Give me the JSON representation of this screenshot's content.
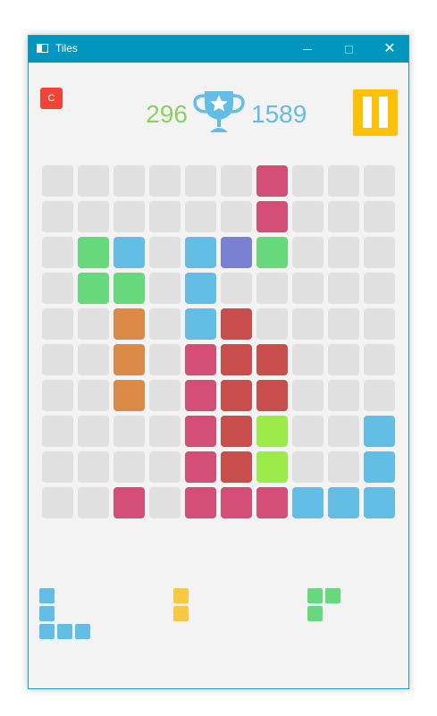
{
  "window": {
    "title": "Tiles",
    "controls": {
      "minimize": "minimize",
      "maximize": "maximize",
      "close": "✕"
    }
  },
  "hud": {
    "reset_label": "C",
    "score": "296",
    "best_score": "1589",
    "icons": {
      "trophy": "trophy-star-icon",
      "pause": "pause-icon"
    }
  },
  "colors": {
    "empty": "#e0e0e0",
    "P": "#d44f77",
    "B": "#64bde4",
    "G": "#67d87c",
    "O": "#dc8a48",
    "V": "#7c80d2",
    "R": "#c94f4f",
    "L": "#9deb4b",
    "Y": "#f7c843",
    "reset": "#f44336",
    "pause": "#ffc107",
    "score": "#8cd15f",
    "best": "#64bde4"
  },
  "board": {
    "size": 10,
    "rows": [
      "......P...",
      "......P...",
      ".GB.BVG...",
      ".GG.B.....",
      "..O.BR....",
      "..O.PRR...",
      "..O.PRR...",
      "....PRL..B",
      "....PRL..B",
      "..P.PPPBBB"
    ]
  },
  "pieces": [
    {
      "color": "B",
      "cells": [
        [
          0,
          0
        ],
        [
          0,
          1
        ],
        [
          0,
          2
        ],
        [
          1,
          2
        ],
        [
          2,
          2
        ]
      ]
    },
    {
      "color": "Y",
      "cells": [
        [
          0,
          0
        ],
        [
          0,
          1
        ]
      ]
    },
    {
      "color": "G",
      "cells": [
        [
          0,
          0
        ],
        [
          1,
          0
        ],
        [
          0,
          1
        ]
      ]
    }
  ]
}
